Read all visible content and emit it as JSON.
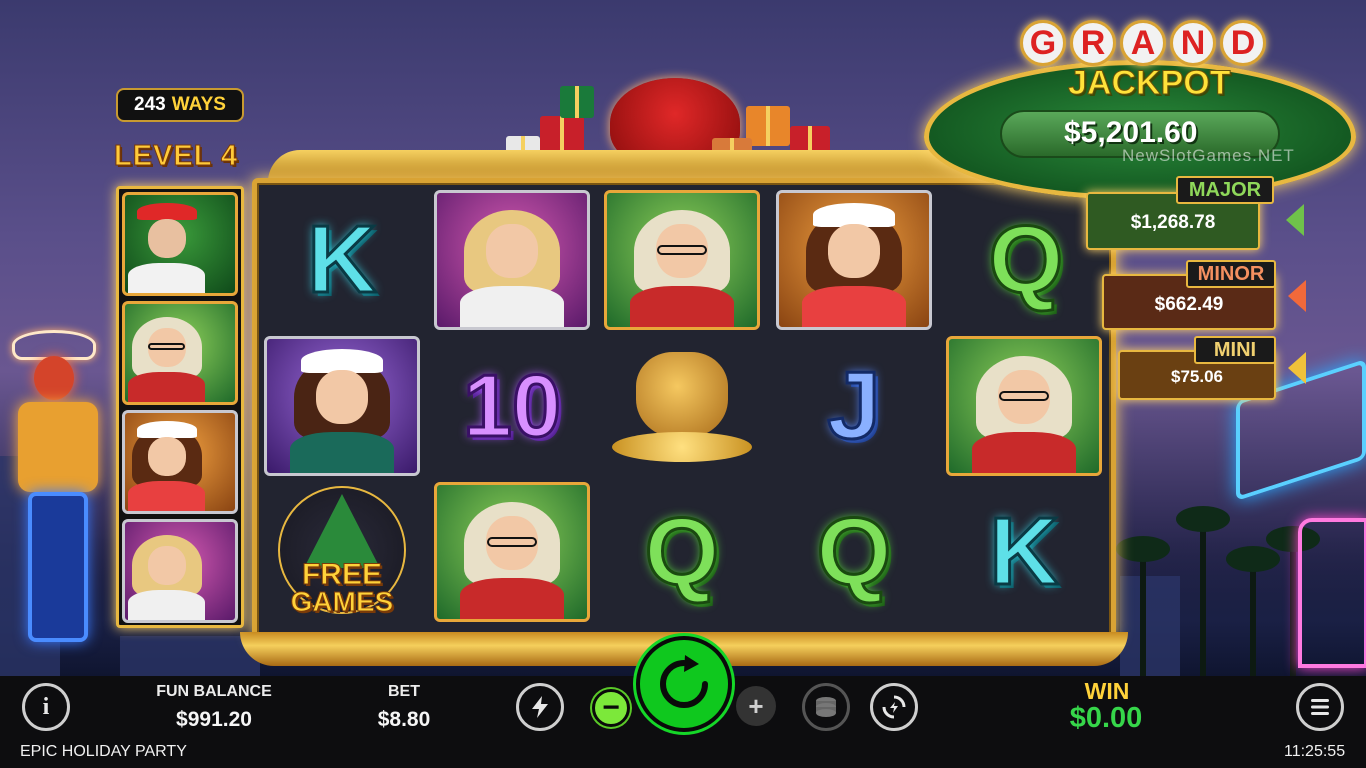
{
  "game": {
    "title": "EPIC HOLIDAY PARTY",
    "clock": "11:25:55",
    "ways_number": "243",
    "ways_word": "WAYS",
    "level": "LEVEL 4"
  },
  "jackpots": {
    "grand_letters": [
      "G",
      "R",
      "A",
      "N",
      "D"
    ],
    "jackpot_label": "JACKPOT",
    "grand_value": "$5,201.60",
    "watermark": "NewSlotGames.NET",
    "major": {
      "label": "MAJOR",
      "value": "$1,268.78",
      "color": "#6fc24a"
    },
    "minor": {
      "label": "MINOR",
      "value": "$662.49",
      "color": "#f2693a"
    },
    "mini": {
      "label": "MINI",
      "value": "$75.06",
      "color": "#f0c23a"
    }
  },
  "reels": {
    "row1": [
      "K",
      "blonde-lady",
      "glasses-lady",
      "santa-hat-lady",
      "Q"
    ],
    "row2": [
      "santa-hat-lady-purple",
      "10",
      "gold-coin-bag",
      "J",
      "glasses-lady"
    ],
    "row3": [
      "free-games",
      "glasses-lady",
      "Q",
      "Q",
      "K"
    ],
    "free_games_line1": "FREE",
    "free_games_line2": "GAMES"
  },
  "side_reel": [
    "santa",
    "glasses-lady",
    "santa-hat-lady",
    "blonde-lady"
  ],
  "bottom_bar": {
    "info_icon": "i",
    "fun_balance_label": "FUN BALANCE",
    "fun_balance_value": "$991.20",
    "bet_label": "BET",
    "bet_value": "$8.80",
    "turbo_icon": "lightning-icon",
    "minus_label": "−",
    "plus_label": "+",
    "spin_icon": "refresh-icon",
    "coins_icon": "coin-stack-icon",
    "autoplay_icon": "autoplay-icon",
    "win_label": "WIN",
    "win_value": "$0.00",
    "menu_icon": "menu-icon"
  },
  "colors": {
    "gold": "#e8b840",
    "spin_green": "#0fc81e",
    "win_green": "#36d64a"
  }
}
